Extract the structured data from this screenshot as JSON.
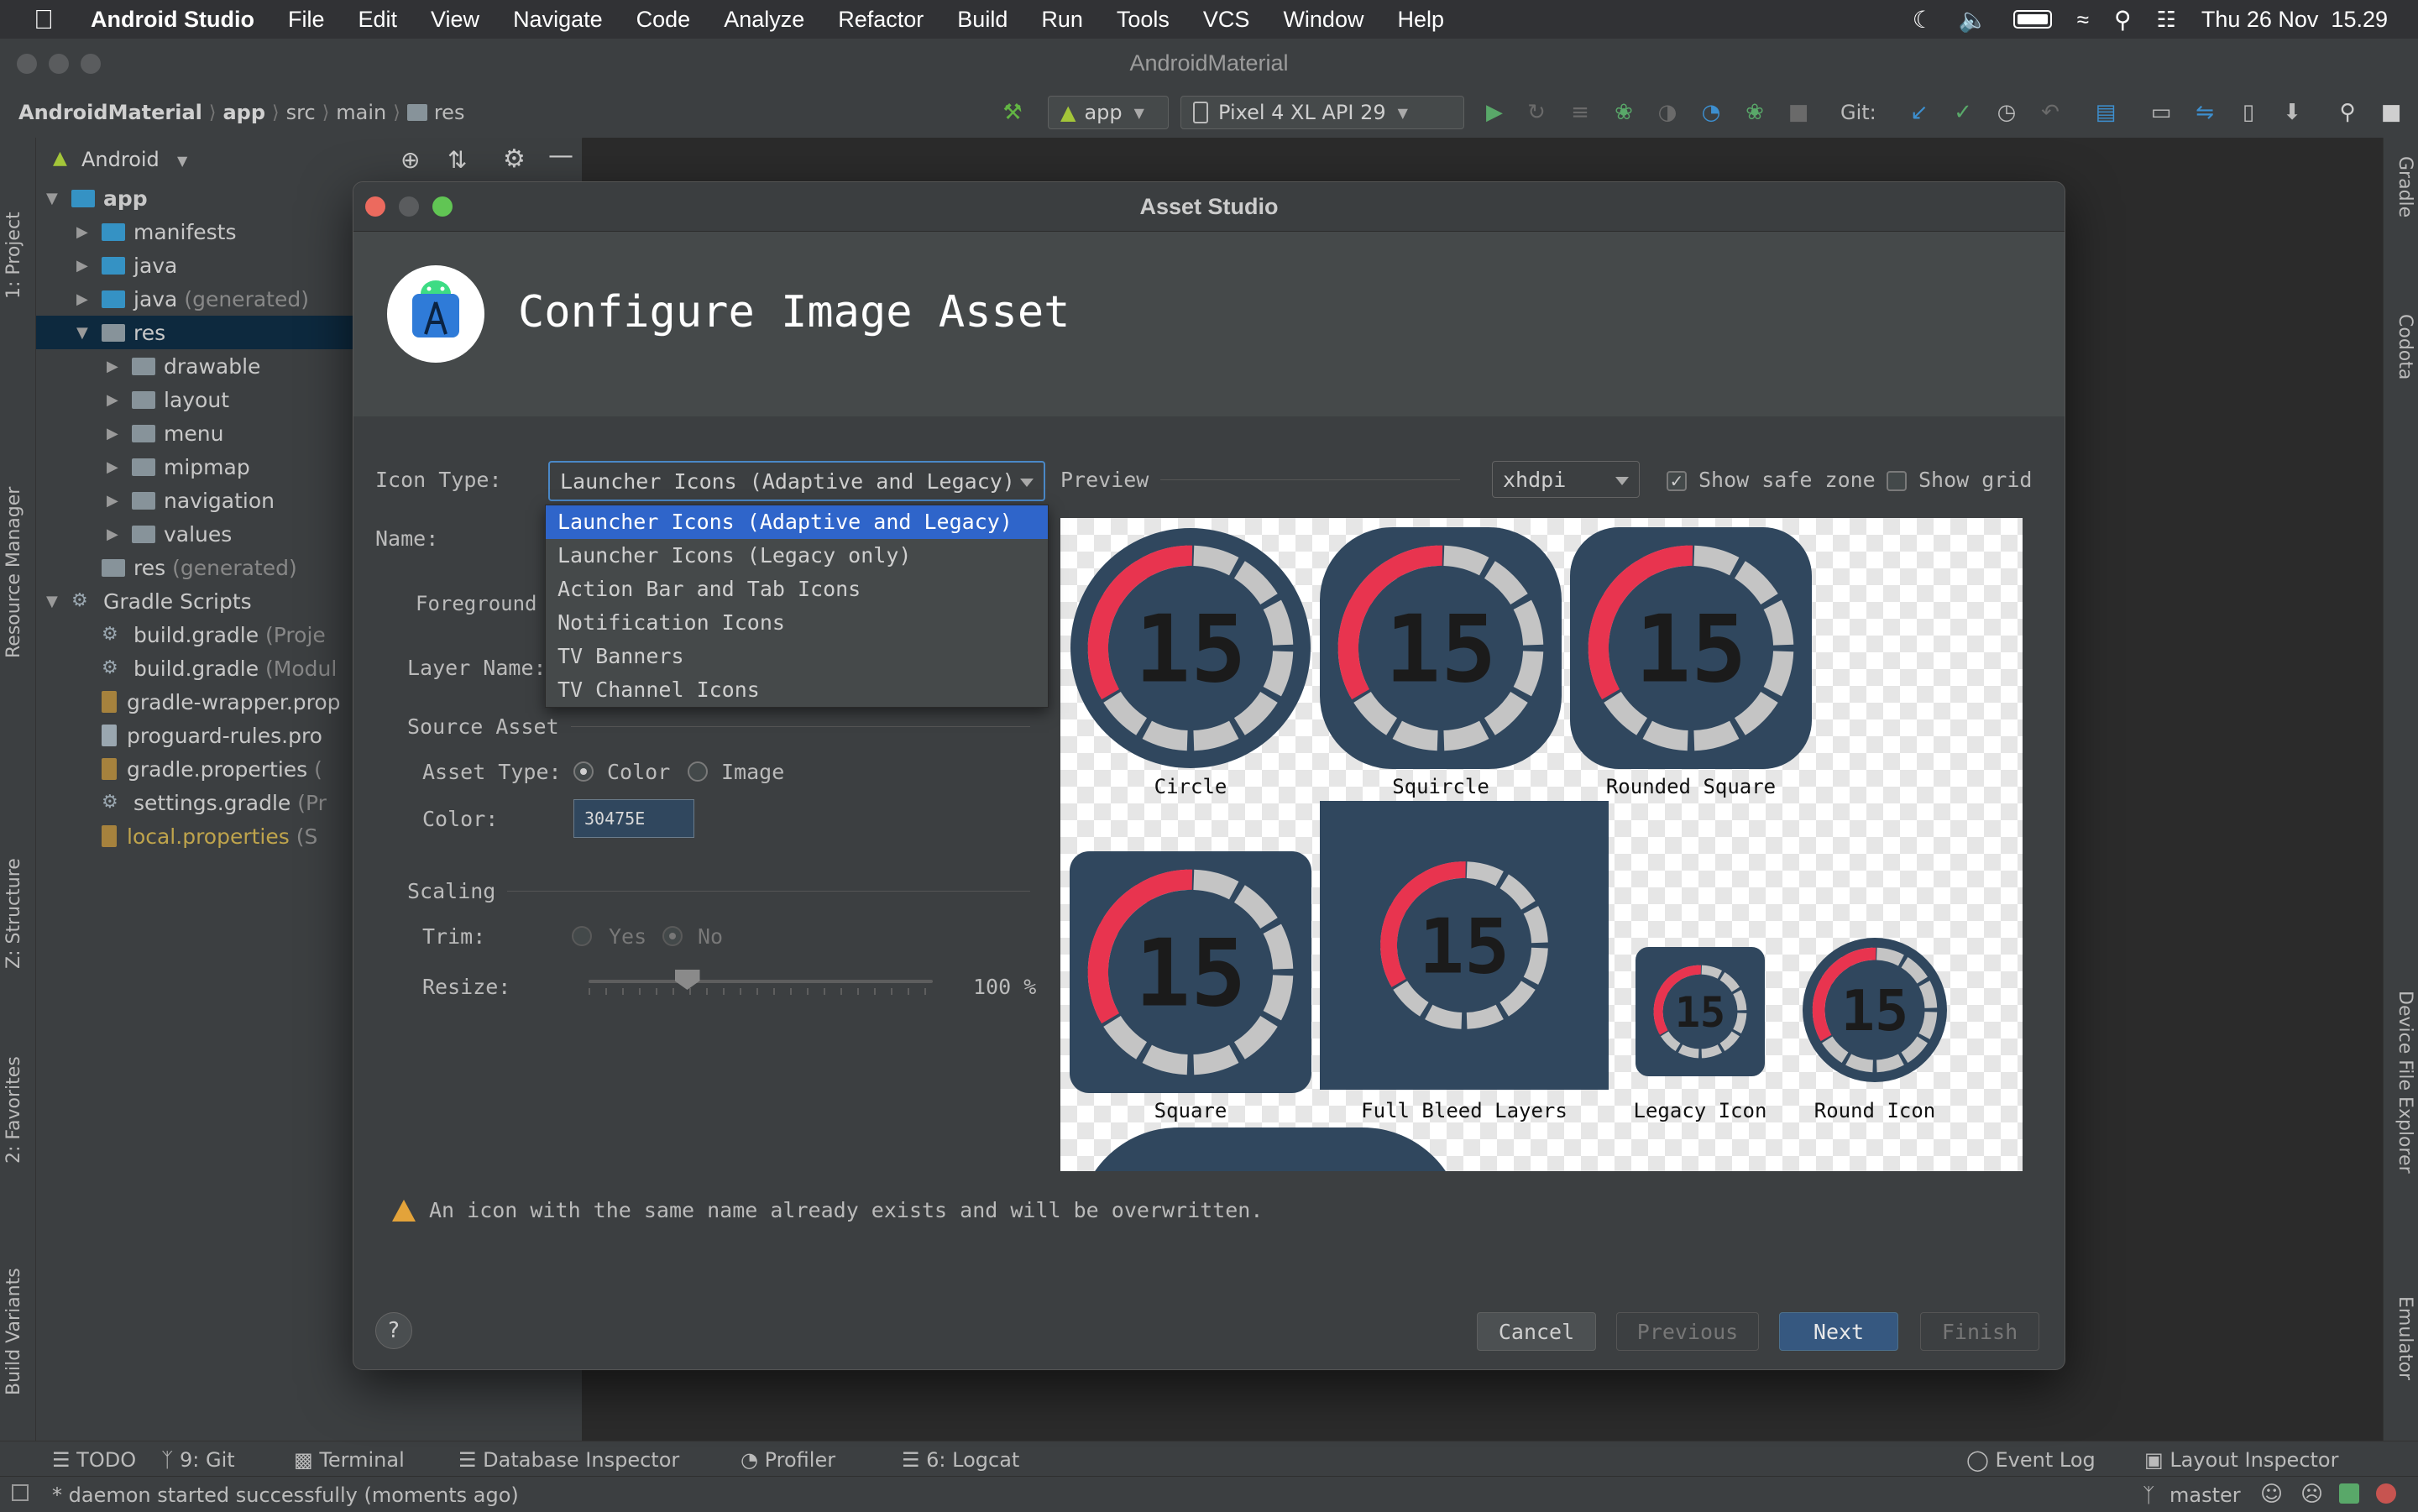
{
  "menubar": {
    "app_name": "Android Studio",
    "items": [
      "File",
      "Edit",
      "View",
      "Navigate",
      "Code",
      "Analyze",
      "Refactor",
      "Build",
      "Run",
      "Tools",
      "VCS",
      "Window",
      "Help"
    ],
    "clock": "Thu 26 Nov  15.29"
  },
  "window": {
    "title": "AndroidMaterial"
  },
  "navbar": {
    "crumbs": [
      "AndroidMaterial",
      "app",
      "src",
      "main",
      "res"
    ],
    "run_config": "app",
    "device": "Pixel 4 XL API 29",
    "git_label": "Git:"
  },
  "left_tabs": [
    "1: Project",
    "Resource Manager",
    "Z: Structure",
    "2: Favorites",
    "Build Variants"
  ],
  "right_tabs": [
    "Gradle",
    "Codota",
    "Device File Explorer",
    "Emulator"
  ],
  "project_panel": {
    "view_selector": "Android",
    "tree": [
      {
        "label": "app",
        "level": 0,
        "expanded": true,
        "icon": "module-folder-icon",
        "bold": true
      },
      {
        "label": "manifests",
        "level": 1,
        "expanded": false,
        "icon": "folder-icon"
      },
      {
        "label": "java",
        "level": 1,
        "expanded": false,
        "icon": "folder-icon"
      },
      {
        "label": "java",
        "suffix": " (generated)",
        "level": 1,
        "expanded": false,
        "icon": "generated-folder-icon"
      },
      {
        "label": "res",
        "level": 1,
        "expanded": true,
        "icon": "res-folder-icon",
        "selected": true
      },
      {
        "label": "drawable",
        "level": 2,
        "expanded": false,
        "icon": "folder-icon"
      },
      {
        "label": "layout",
        "level": 2,
        "expanded": false,
        "icon": "folder-icon"
      },
      {
        "label": "menu",
        "level": 2,
        "expanded": false,
        "icon": "folder-icon"
      },
      {
        "label": "mipmap",
        "level": 2,
        "expanded": false,
        "icon": "folder-icon"
      },
      {
        "label": "navigation",
        "level": 2,
        "expanded": false,
        "icon": "folder-icon"
      },
      {
        "label": "values",
        "level": 2,
        "expanded": false,
        "icon": "folder-icon"
      },
      {
        "label": "res",
        "suffix": " (generated)",
        "level": 1,
        "icon": "res-folder-icon"
      },
      {
        "label": "Gradle Scripts",
        "level": 0,
        "expanded": true,
        "icon": "gradle-icon"
      },
      {
        "label": "build.gradle",
        "suffix": " (Proje",
        "level": 1,
        "icon": "gradle-file-icon"
      },
      {
        "label": "build.gradle",
        "suffix": " (Modul",
        "level": 1,
        "icon": "gradle-file-icon"
      },
      {
        "label": "gradle-wrapper.prop",
        "level": 1,
        "icon": "properties-file-icon"
      },
      {
        "label": "proguard-rules.pro",
        "level": 1,
        "icon": "text-file-icon"
      },
      {
        "label": "gradle.properties",
        "suffix": " (",
        "level": 1,
        "icon": "properties-file-icon"
      },
      {
        "label": "settings.gradle",
        "suffix": " (Pr",
        "level": 1,
        "icon": "gradle-file-icon"
      },
      {
        "label": "local.properties",
        "suffix": " (S",
        "level": 1,
        "icon": "properties-file-icon",
        "highlight": true
      }
    ]
  },
  "dialog": {
    "window_title": "Asset Studio",
    "heading": "Configure Image Asset",
    "icon_type_label": "Icon Type:",
    "icon_type_value": "Launcher Icons (Adaptive and Legacy)",
    "icon_type_options": [
      "Launcher Icons (Adaptive and Legacy)",
      "Launcher Icons (Legacy only)",
      "Action Bar and Tab Icons",
      "Notification Icons",
      "TV Banners",
      "TV Channel Icons"
    ],
    "name_label": "Name:",
    "foreground_tab": "Foreground",
    "layer_name_label": "Layer Name:",
    "source_asset_section": "Source Asset",
    "asset_type_label": "Asset Type:",
    "asset_type_color": "Color",
    "asset_type_image": "Image",
    "color_label": "Color:",
    "color_value": "30475E",
    "scaling_section": "Scaling",
    "trim_label": "Trim:",
    "trim_yes": "Yes",
    "trim_no": "No",
    "resize_label": "Resize:",
    "resize_value": "100 %",
    "resize_fraction": 0.25,
    "preview_label": "Preview",
    "density": "xhdpi",
    "show_safe_zone": "Show safe zone",
    "show_grid": "Show grid",
    "preview_items": [
      "Circle",
      "Squircle",
      "Rounded Square",
      "Square",
      "Full Bleed Layers",
      "Legacy Icon",
      "Round Icon"
    ],
    "icon_number": "15",
    "icon_bg_color": "#30475e",
    "icon_accent_color": "#e8344f",
    "icon_ring_color": "#c4c4c4",
    "warning": "An icon with the same name already exists and will be overwritten.",
    "buttons": {
      "help": "?",
      "cancel": "Cancel",
      "previous": "Previous",
      "next": "Next",
      "finish": "Finish"
    }
  },
  "bottom_tabs": [
    {
      "label": "TODO",
      "icon": "list-icon"
    },
    {
      "label": "9: Git",
      "icon": "branch-icon"
    },
    {
      "label": "Terminal",
      "icon": "terminal-icon"
    },
    {
      "label": "Database Inspector",
      "icon": "database-icon"
    },
    {
      "label": "Profiler",
      "icon": "gauge-icon"
    },
    {
      "label": "6: Logcat",
      "icon": "logcat-icon"
    }
  ],
  "bottom_right_tabs": [
    {
      "label": "Event Log",
      "icon": "event-log-icon"
    },
    {
      "label": "Layout Inspector",
      "icon": "layout-inspector-icon"
    }
  ],
  "status": {
    "message": "* daemon started successfully (moments ago)",
    "branch": "master"
  }
}
